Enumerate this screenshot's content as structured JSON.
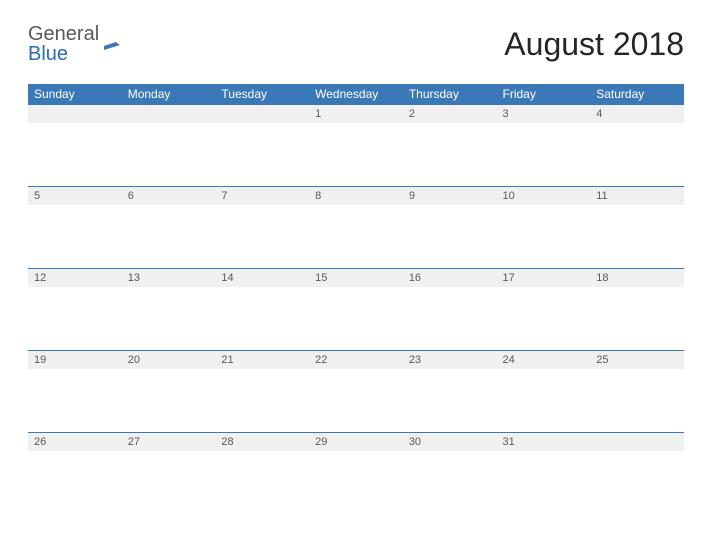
{
  "logo": {
    "text1": "General",
    "text2": "Blue"
  },
  "title": "August 2018",
  "days": [
    "Sunday",
    "Monday",
    "Tuesday",
    "Wednesday",
    "Thursday",
    "Friday",
    "Saturday"
  ],
  "weeks": [
    [
      "",
      "",
      "",
      "1",
      "2",
      "3",
      "4"
    ],
    [
      "5",
      "6",
      "7",
      "8",
      "9",
      "10",
      "11"
    ],
    [
      "12",
      "13",
      "14",
      "15",
      "16",
      "17",
      "18"
    ],
    [
      "19",
      "20",
      "21",
      "22",
      "23",
      "24",
      "25"
    ],
    [
      "26",
      "27",
      "28",
      "29",
      "30",
      "31",
      ""
    ]
  ]
}
